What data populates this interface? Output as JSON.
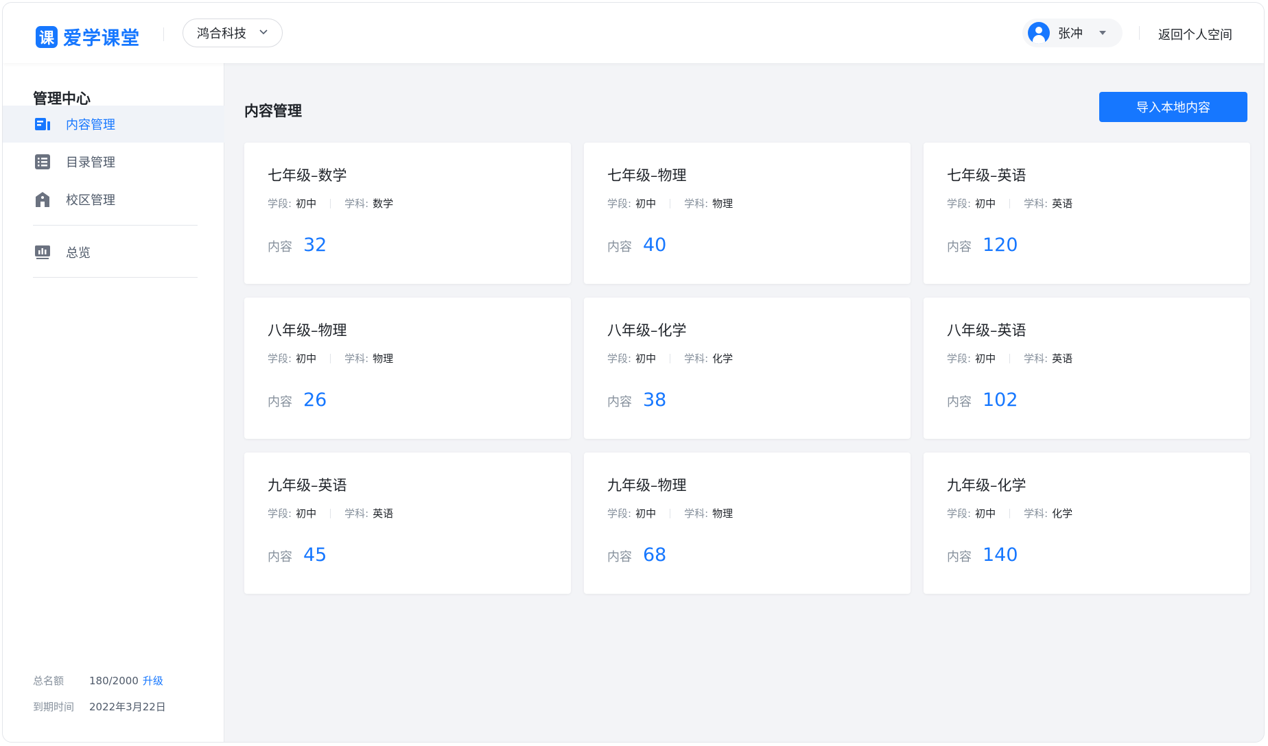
{
  "header": {
    "logo_glyph": "课",
    "logo_text": "爱学课堂",
    "org_name": "鸿合科技",
    "user_name": "张冲",
    "back_link": "返回个人空间"
  },
  "sidebar": {
    "title": "管理中心",
    "items": [
      {
        "label": "内容管理",
        "icon": "content-icon",
        "active": true
      },
      {
        "label": "目录管理",
        "icon": "list-icon",
        "active": false
      },
      {
        "label": "校区管理",
        "icon": "building-icon",
        "active": false
      },
      {
        "label": "总览",
        "icon": "chart-icon",
        "active": false
      }
    ],
    "quota": {
      "total_label": "总名额",
      "total_value": "180/2000",
      "upgrade_label": "升级",
      "expiry_label": "到期时间",
      "expiry_value": "2022年3月22日"
    }
  },
  "main": {
    "title": "内容管理",
    "import_button": "导入本地内容",
    "stage_label": "学段:",
    "subject_label": "学科:",
    "count_label": "内容",
    "cards": [
      {
        "title": "七年级–数学",
        "stage": "初中",
        "subject": "数学",
        "count": "32"
      },
      {
        "title": "七年级–物理",
        "stage": "初中",
        "subject": "物理",
        "count": "40"
      },
      {
        "title": "七年级–英语",
        "stage": "初中",
        "subject": "英语",
        "count": "120"
      },
      {
        "title": "八年级–物理",
        "stage": "初中",
        "subject": "物理",
        "count": "26"
      },
      {
        "title": "八年级–化学",
        "stage": "初中",
        "subject": "化学",
        "count": "38"
      },
      {
        "title": "八年级–英语",
        "stage": "初中",
        "subject": "英语",
        "count": "102"
      },
      {
        "title": "九年级–英语",
        "stage": "初中",
        "subject": "英语",
        "count": "45"
      },
      {
        "title": "九年级–物理",
        "stage": "初中",
        "subject": "物理",
        "count": "68"
      },
      {
        "title": "九年级–化学",
        "stage": "初中",
        "subject": "化学",
        "count": "140"
      }
    ]
  },
  "colors": {
    "accent": "#1677ff",
    "background": "#f3f4f7",
    "muted_text": "#86909c"
  }
}
